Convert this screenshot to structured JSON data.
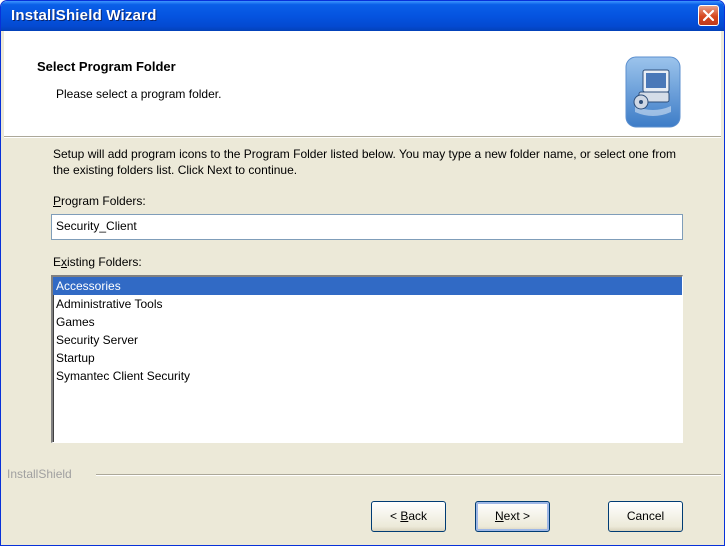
{
  "window": {
    "title": "InstallShield Wizard"
  },
  "header": {
    "title": "Select Program Folder",
    "subtitle": "Please select a program folder."
  },
  "content": {
    "description": "Setup will add program icons to the Program Folder listed below.  You may type a new folder name, or select one from the existing folders list.  Click Next to continue.",
    "program_folders_label": {
      "accel": "P",
      "rest": "rogram Folders:"
    },
    "program_folder_value": "Security_Client",
    "existing_folders_label": {
      "pre": "E",
      "accel": "x",
      "rest": "isting Folders:"
    },
    "existing_folders": [
      "Accessories",
      "Administrative Tools",
      "Games",
      "Security Server",
      "Startup",
      "Symantec Client Security"
    ],
    "selected_folder": "Accessories"
  },
  "footer": {
    "brand": "InstallShield",
    "back": {
      "prefix": "< ",
      "accel": "B",
      "rest": "ack"
    },
    "next": {
      "accel": "N",
      "rest": "ext >"
    },
    "cancel": "Cancel"
  },
  "colors": {
    "titlebar": "#0554e0",
    "selection": "#316ac5",
    "close_button": "#d6481f",
    "dialog_face": "#ece9d8"
  },
  "icons": [
    "close-icon",
    "setup-computer-graphic"
  ]
}
